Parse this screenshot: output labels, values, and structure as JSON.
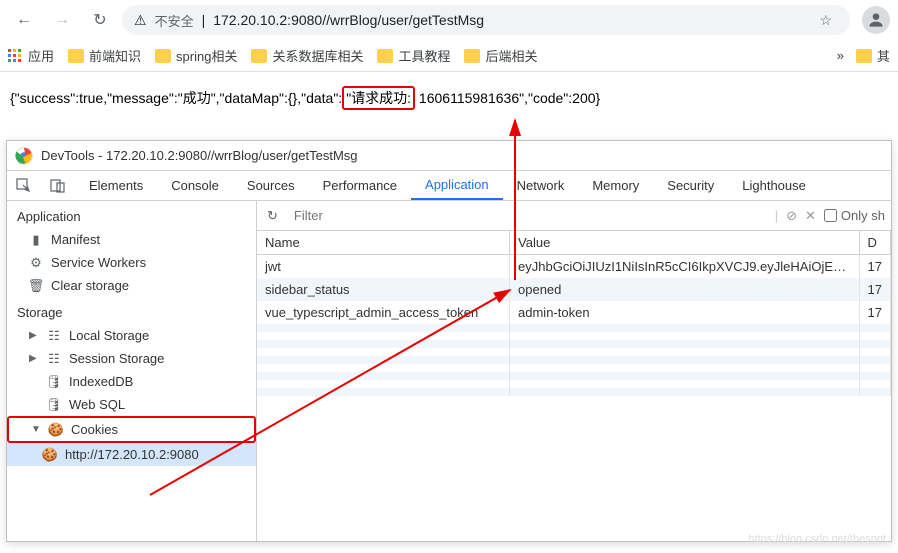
{
  "browser": {
    "insecure_label": "不安全",
    "url": "172.20.10.2:9080//wrrBlog/user/getTestMsg"
  },
  "bookmarks": {
    "apps": "应用",
    "items": [
      "前端知识",
      "spring相关",
      "关系数据库相关",
      "工具教程",
      "后端相关"
    ],
    "more": "»",
    "other": "其"
  },
  "json_response": {
    "prefix": "{\"success\":true,\"message\":\"成功\",\"dataMap\":{},\"data\":",
    "highlight": "\"请求成功:",
    "suffix": " 1606115981636\",\"code\":200}"
  },
  "devtools": {
    "title": "DevTools - 172.20.10.2:9080//wrrBlog/user/getTestMsg",
    "tabs": [
      "Elements",
      "Console",
      "Sources",
      "Performance",
      "Application",
      "Network",
      "Memory",
      "Security",
      "Lighthouse"
    ],
    "active_tab": "Application",
    "sidebar": {
      "app_section": "Application",
      "app_items": [
        "Manifest",
        "Service Workers",
        "Clear storage"
      ],
      "storage_section": "Storage",
      "storage_items": [
        "Local Storage",
        "Session Storage",
        "IndexedDB",
        "Web SQL",
        "Cookies"
      ],
      "cookie_origin": "http://172.20.10.2:9080"
    },
    "filter": {
      "placeholder": "Filter",
      "only_label": "Only sh"
    },
    "table": {
      "headers": [
        "Name",
        "Value",
        "D"
      ],
      "rows": [
        {
          "name": "jwt",
          "value": "eyJhbGciOiJIUzI1NiIsInR5cCI6IkpXVCJ9.eyJleHAiOjE…",
          "d": "17"
        },
        {
          "name": "sidebar_status",
          "value": "opened",
          "d": "17"
        },
        {
          "name": "vue_typescript_admin_access_token",
          "value": "admin-token",
          "d": "17"
        }
      ]
    }
  },
  "watermark": "https://blog.csdn.net/thesprit"
}
